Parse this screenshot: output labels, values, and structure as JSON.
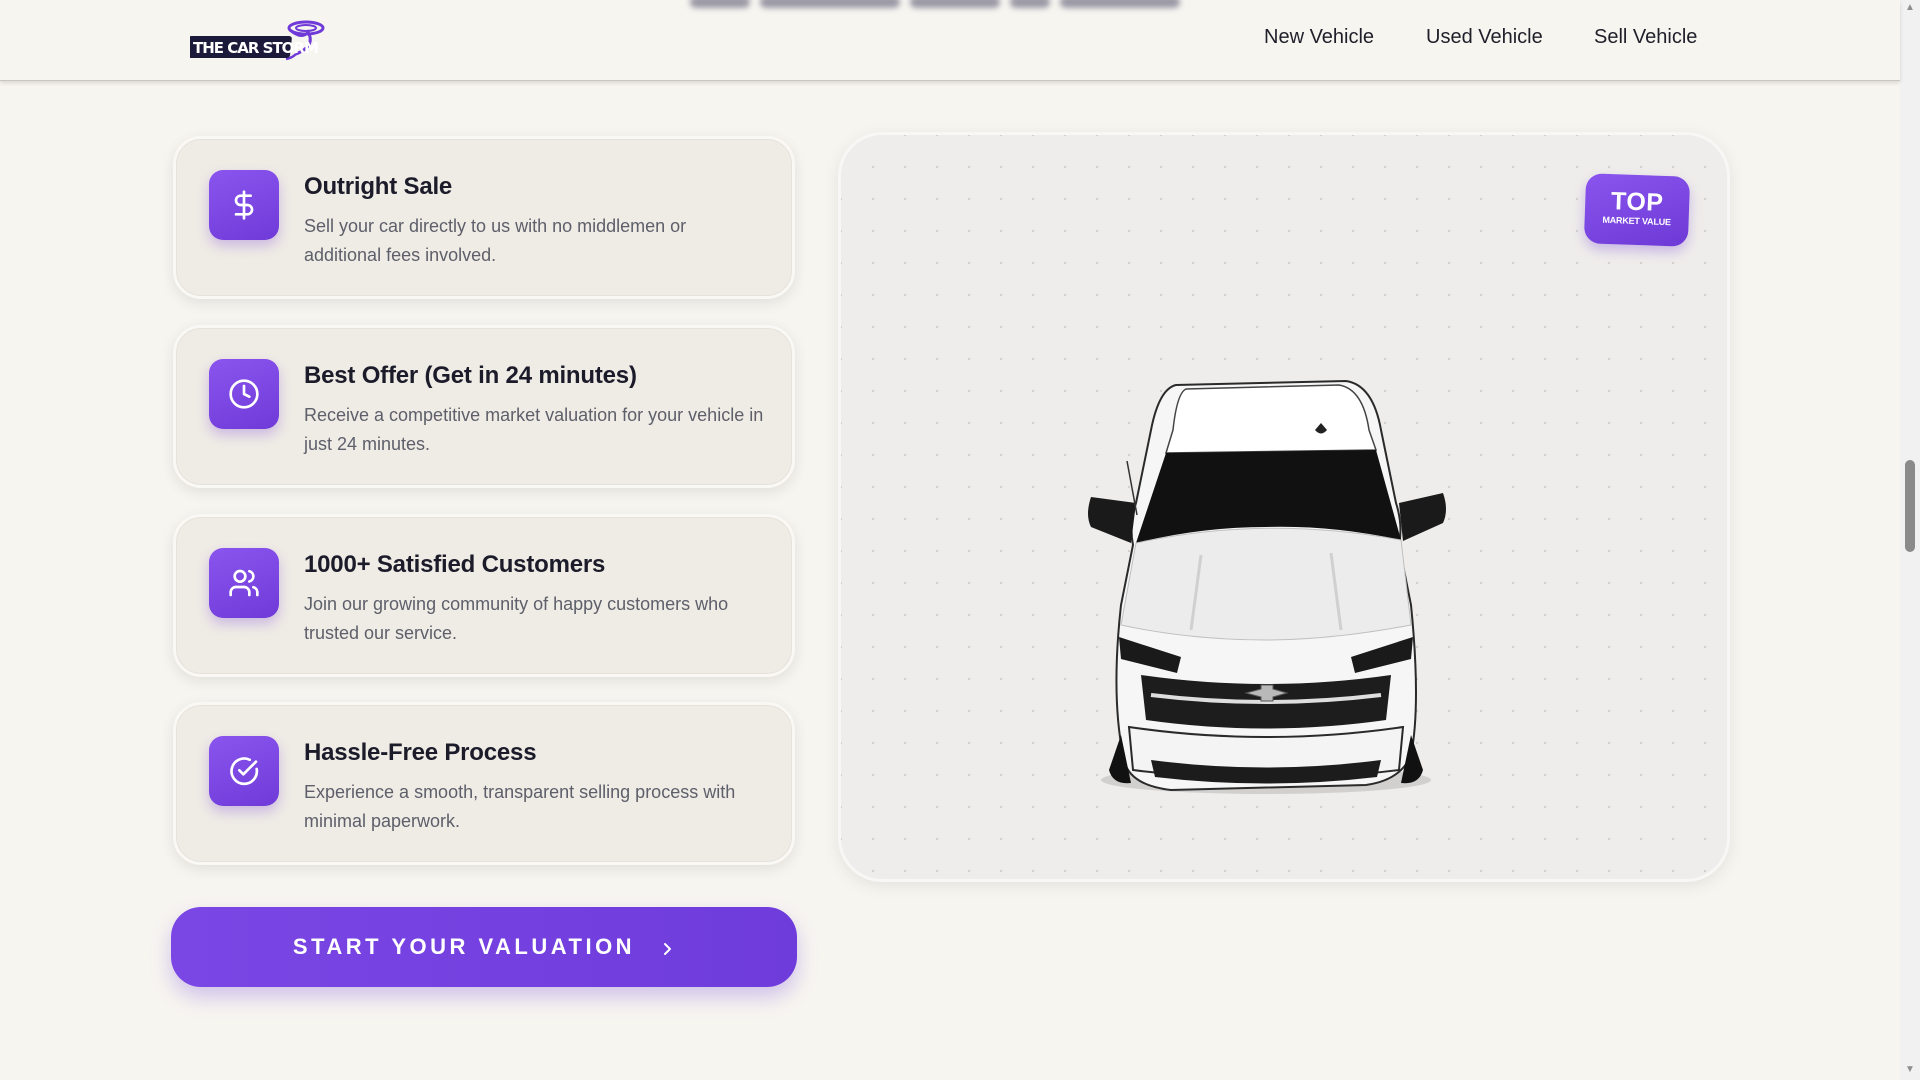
{
  "header": {
    "logo_text": "THE CAR STORM",
    "nav": {
      "new_vehicle": "New Vehicle",
      "used_vehicle": "Used Vehicle",
      "sell_vehicle": "Sell Vehicle"
    }
  },
  "features": [
    {
      "icon": "dollar-icon",
      "title": "Outright Sale",
      "description": "Sell your car directly to us with no middlemen or additional fees involved."
    },
    {
      "icon": "clock-icon",
      "title": "Best Offer (Get in 24 minutes)",
      "description": "Receive a competitive market valuation for your vehicle in just 24 minutes."
    },
    {
      "icon": "users-icon",
      "title": "1000+ Satisfied Customers",
      "description": "Join our growing community of happy customers who trusted our service."
    },
    {
      "icon": "check-circle-icon",
      "title": "Hassle-Free Process",
      "description": "Experience a smooth, transparent selling process with minimal paperwork."
    }
  ],
  "cta": {
    "label": "START YOUR VALUATION",
    "icon": "chevron-right-icon"
  },
  "badge": {
    "top": "TOP",
    "sub": "MARKET VALUE"
  },
  "colors": {
    "accent": "#7442de",
    "background": "#f7f5f0",
    "card": "#efebe5",
    "text": "#1b1b2a",
    "muted": "#5d5f6a"
  }
}
